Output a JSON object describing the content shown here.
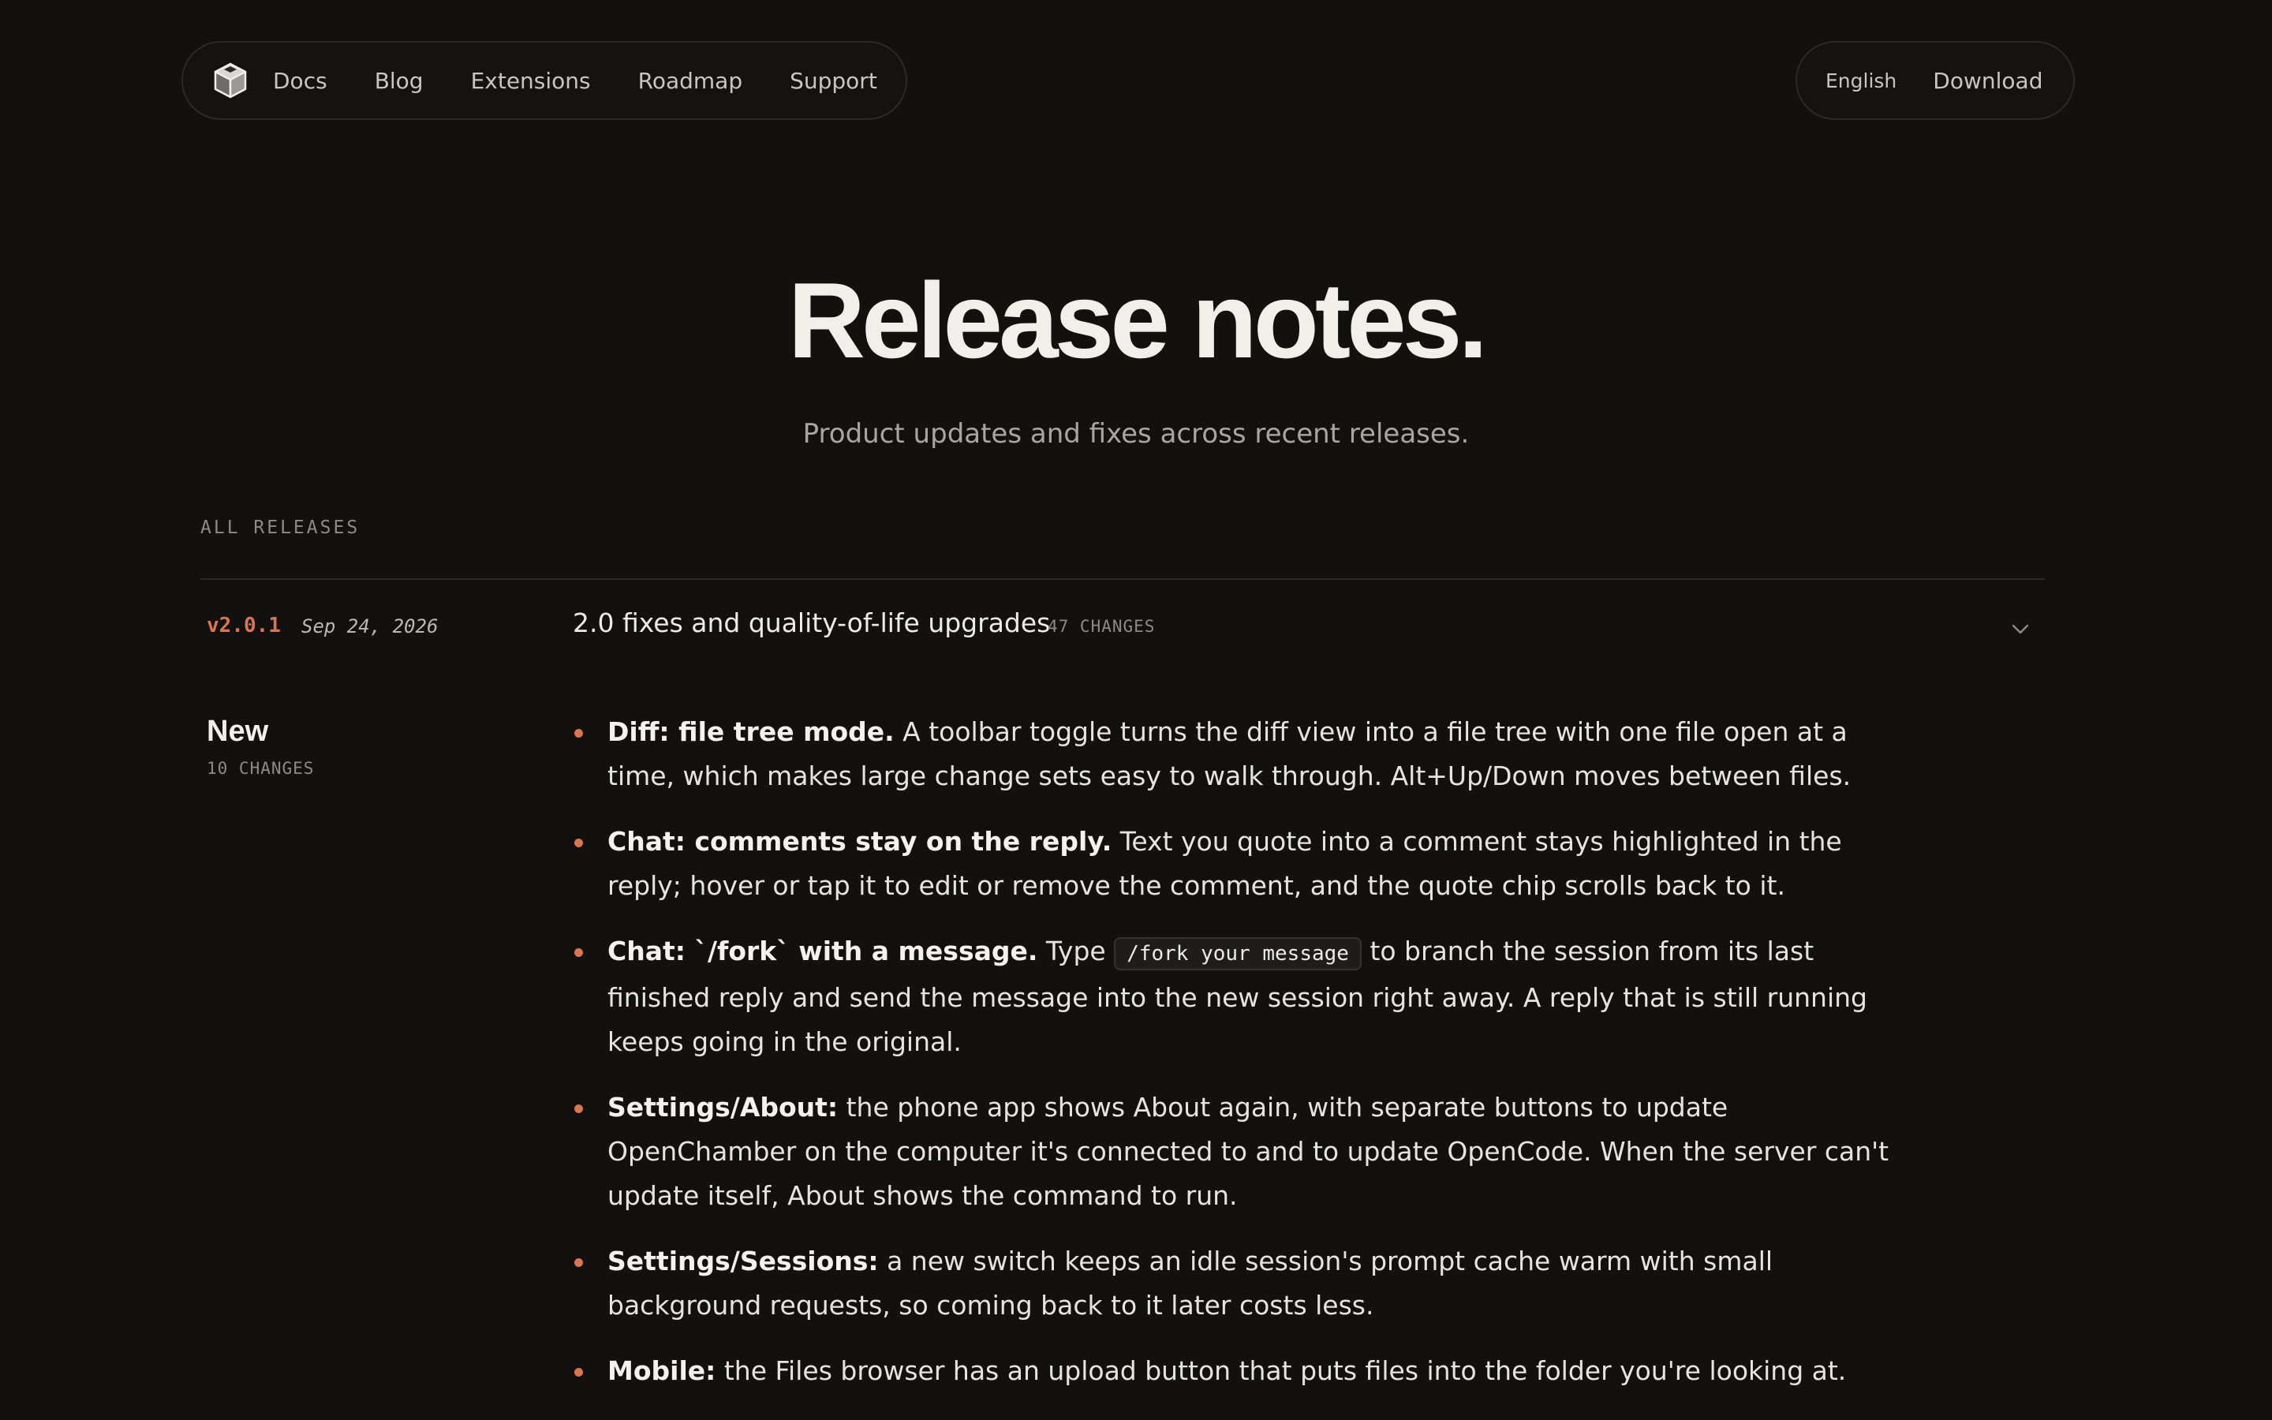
{
  "nav": {
    "links": [
      "Docs",
      "Blog",
      "Extensions",
      "Roadmap",
      "Support"
    ],
    "language": "English",
    "download": "Download",
    "logo_icon": "cube-logo-icon"
  },
  "hero": {
    "title": "Release notes.",
    "subtitle": "Product updates and fixes across recent releases."
  },
  "section": {
    "label": "ALL RELEASES"
  },
  "release": {
    "version": "v2.0.1",
    "date": "Sep 24, 2026",
    "title": "2.0 fixes and quality-of-life upgrades",
    "count": "47 CHANGES",
    "chevron_icon": "chevron-down-icon"
  },
  "group": {
    "title": "New",
    "count": "10 CHANGES"
  },
  "notes": [
    {
      "strong": "Diff: file tree mode.",
      "text": " A toolbar toggle turns the diff view into a file tree with one file open at a time, which makes large change sets easy to walk through. Alt+Up/Down moves between files."
    },
    {
      "strong": "Chat: comments stay on the reply.",
      "text": " Text you quote into a comment stays highlighted in the reply; hover or tap it to edit or remove the comment, and the quote chip scrolls back to it."
    },
    {
      "strong": "Chat: `/fork` with a message.",
      "before": " Type ",
      "code": "/fork your message",
      "text": " to branch the session from its last finished reply and send the message into the new session right away. A reply that is still running keeps going in the original."
    },
    {
      "strong": "Settings/About:",
      "text": " the phone app shows About again, with separate buttons to update OpenChamber on the computer it's connected to and to update OpenCode. When the server can't update itself, About shows the command to run."
    },
    {
      "strong": "Settings/Sessions:",
      "text": " a new switch keeps an idle session's prompt cache warm with small background requests, so coming back to it later costs less."
    },
    {
      "strong": "Mobile:",
      "text": " the Files browser has an upload button that puts files into the folder you're looking at."
    }
  ]
}
